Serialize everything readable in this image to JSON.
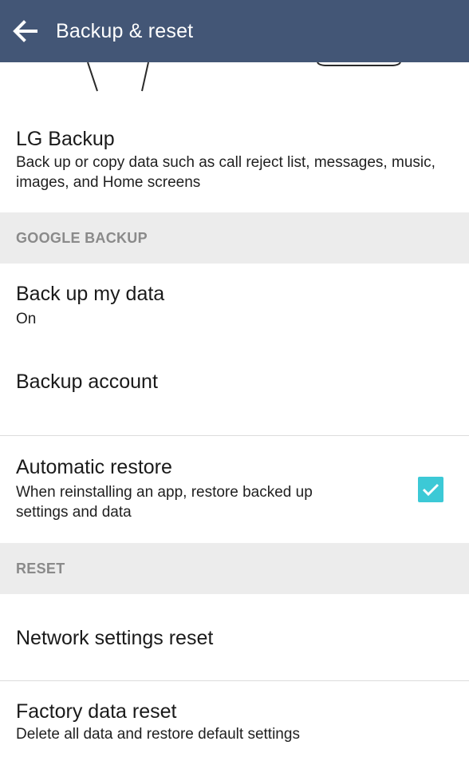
{
  "appbar": {
    "title": "Backup & reset",
    "back_icon": "arrow-left-icon"
  },
  "lg_backup": {
    "title": "LG Backup",
    "summary": "Back up or copy data such as call reject list, messages, music, images, and Home screens"
  },
  "google_backup": {
    "header": "GOOGLE BACKUP",
    "back_up_my_data": {
      "title": "Back up my data",
      "summary": "On"
    },
    "backup_account": {
      "title": "Backup account"
    },
    "automatic_restore": {
      "title": "Automatic restore",
      "summary": "When reinstalling an app, restore backed up settings and data",
      "checked": true
    }
  },
  "reset": {
    "header": "RESET",
    "network_settings_reset": {
      "title": "Network settings reset"
    },
    "factory_data_reset": {
      "title": "Factory data reset",
      "summary": "Delete all data and restore default settings"
    }
  },
  "colors": {
    "appbar": "#435676",
    "section_bg": "#ececec",
    "section_text": "#8a8a8a",
    "checkbox": "#3cc9d6"
  }
}
